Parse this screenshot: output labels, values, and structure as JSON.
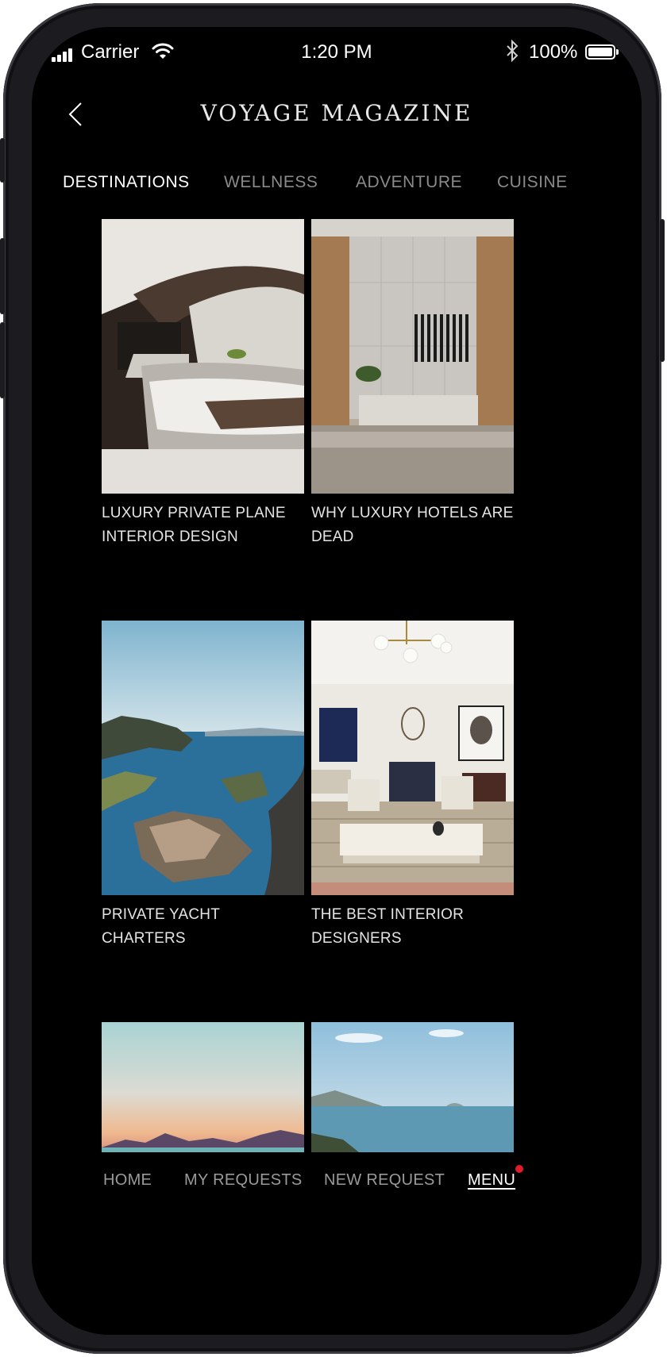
{
  "status_bar": {
    "carrier": "Carrier",
    "time": "1:20 PM",
    "battery": "100%"
  },
  "header": {
    "back_icon": "chevron-left-icon",
    "title": "VOYAGE MAGAZINE"
  },
  "tabs": [
    {
      "label": "DESTINATIONS",
      "active": true
    },
    {
      "label": "WELLNESS",
      "active": false
    },
    {
      "label": "ADVENTURE",
      "active": false
    },
    {
      "label": "CUISINE",
      "active": false
    }
  ],
  "articles": [
    {
      "title": "LUXURY PRIVATE PLANE INTERIOR DESIGN"
    },
    {
      "title": "WHY LUXURY HOTELS ARE DEAD"
    },
    {
      "title": "PRIVATE YACHT CHARTERS"
    },
    {
      "title": "THE BEST INTERIOR DESIGNERS"
    },
    {
      "title": ""
    },
    {
      "title": ""
    }
  ],
  "bottom_nav": [
    {
      "label": "HOME",
      "active": false
    },
    {
      "label": "MY REQUESTS",
      "active": false
    },
    {
      "label": "NEW REQUEST",
      "active": false
    },
    {
      "label": "MENU",
      "active": true
    }
  ],
  "colors": {
    "background": "#000000",
    "accent_dot": "#e21b2b",
    "inactive_text": "#8a8a8a",
    "active_text": "#ffffff"
  }
}
